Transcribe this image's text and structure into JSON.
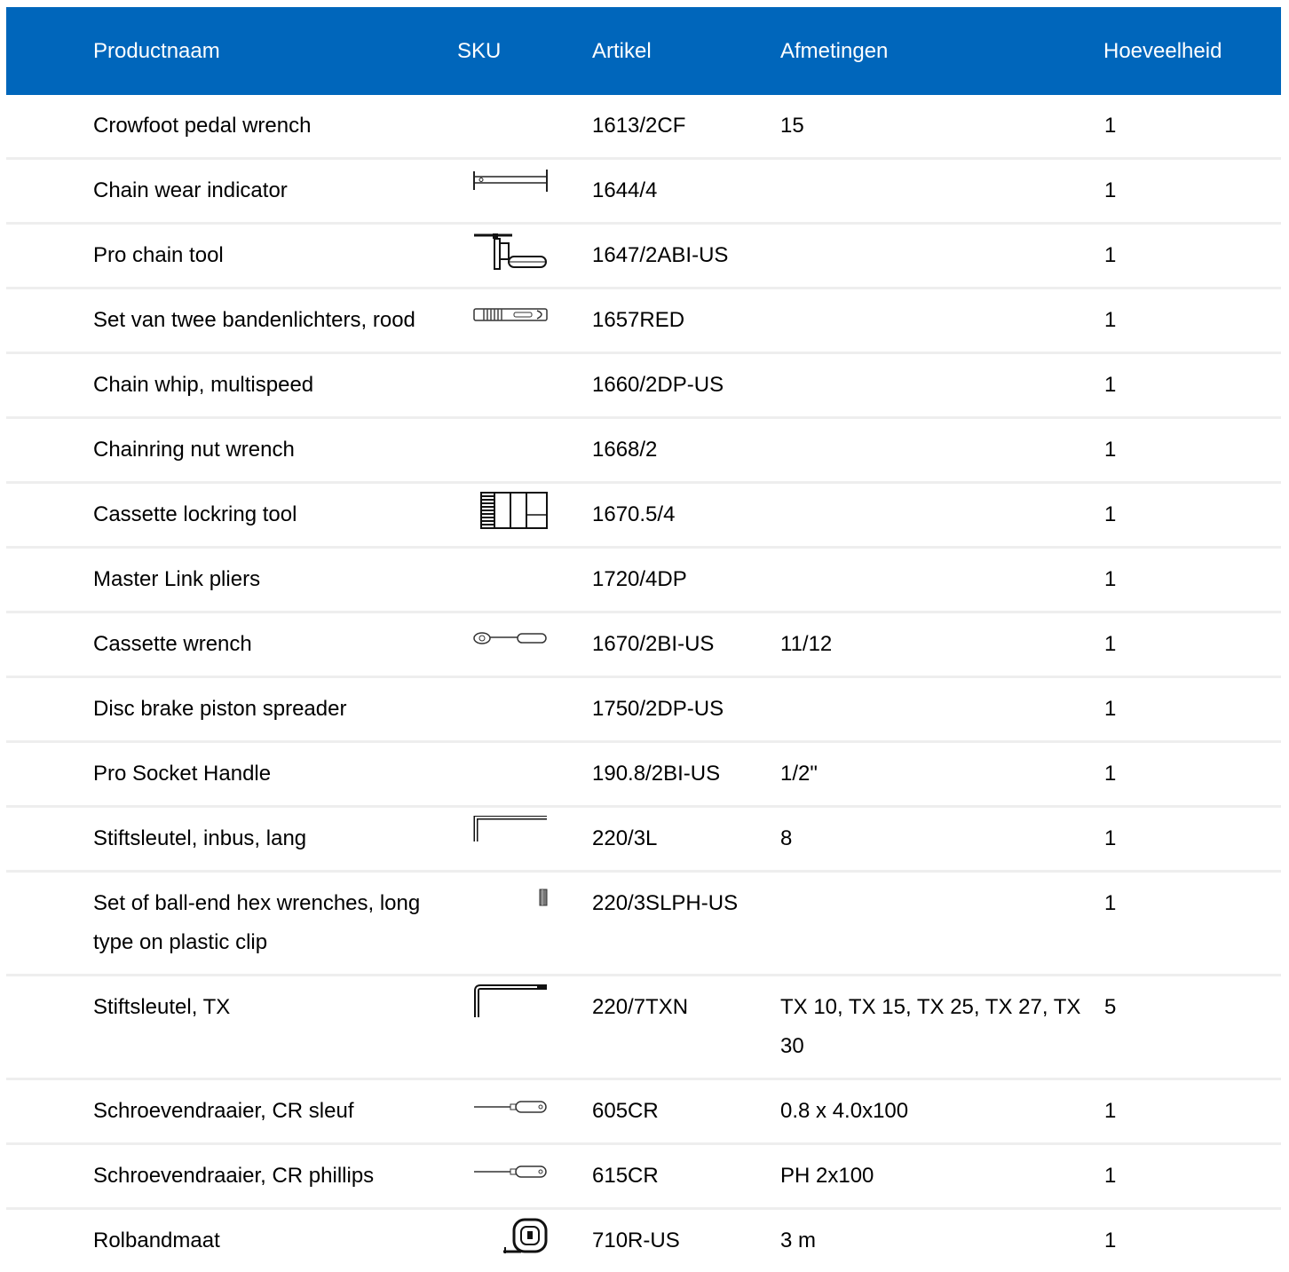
{
  "table": {
    "headers": {
      "product": "Productnaam",
      "sku": "SKU",
      "article": "Artikel",
      "dimensions": "Afmetingen",
      "quantity": "Hoeveelheid"
    },
    "colors": {
      "header_bg": "#0066bb",
      "header_text": "#ffffff",
      "row_divider": "#eeeeee"
    },
    "rows": [
      {
        "name": "Crowfoot pedal wrench",
        "icon": "",
        "article": "1613/2CF",
        "dimensions": "15",
        "qty": "1"
      },
      {
        "name": "Chain wear indicator",
        "icon": "chain-wear-indicator-icon",
        "article": "1644/4",
        "dimensions": "",
        "qty": "1"
      },
      {
        "name": "Pro chain tool",
        "icon": "chain-tool-icon",
        "article": "1647/2ABI-US",
        "dimensions": "",
        "qty": "1"
      },
      {
        "name": "Set van twee bandenlichters, rood",
        "icon": "tire-lever-icon",
        "article": "1657RED",
        "dimensions": "",
        "qty": "1"
      },
      {
        "name": "Chain whip, multispeed",
        "icon": "",
        "article": "1660/2DP-US",
        "dimensions": "",
        "qty": "1"
      },
      {
        "name": "Chainring nut wrench",
        "icon": "",
        "article": "1668/2",
        "dimensions": "",
        "qty": "1"
      },
      {
        "name": "Cassette lockring tool",
        "icon": "lockring-tool-icon",
        "article": "1670.5/4",
        "dimensions": "",
        "qty": "1"
      },
      {
        "name": "Master Link pliers",
        "icon": "",
        "article": "1720/4DP",
        "dimensions": "",
        "qty": "1"
      },
      {
        "name": "Cassette wrench",
        "icon": "ratchet-wrench-icon",
        "article": "1670/2BI-US",
        "dimensions": "11/12",
        "qty": "1"
      },
      {
        "name": "Disc brake piston spreader",
        "icon": "",
        "article": "1750/2DP-US",
        "dimensions": "",
        "qty": "1"
      },
      {
        "name": "Pro Socket Handle",
        "icon": "",
        "article": "190.8/2BI-US",
        "dimensions": "1/2\"",
        "qty": "1"
      },
      {
        "name": "Stiftsleutel, inbus, lang",
        "icon": "hex-key-long-icon",
        "article": "220/3L",
        "dimensions": "8",
        "qty": "1"
      },
      {
        "name": "Set of ball-end hex wrenches, long type on plastic clip",
        "icon": "hex-set-clip-icon",
        "article": "220/3SLPH-US",
        "dimensions": "",
        "qty": "1"
      },
      {
        "name": "Stiftsleutel, TX",
        "icon": "torx-key-icon",
        "article": "220/7TXN",
        "dimensions": "TX 10, TX 15, TX 25, TX 27, TX 30",
        "qty": "5"
      },
      {
        "name": "Schroevendraaier, CR sleuf",
        "icon": "flat-screwdriver-icon",
        "article": "605CR",
        "dimensions": "0.8 x 4.0x100",
        "qty": "1"
      },
      {
        "name": "Schroevendraaier, CR phillips",
        "icon": "phillips-screwdriver-icon",
        "article": "615CR",
        "dimensions": "PH 2x100",
        "qty": "1"
      },
      {
        "name": "Rolbandmaat",
        "icon": "tape-measure-icon",
        "article": "710R-US",
        "dimensions": "3 m",
        "qty": "1"
      }
    ]
  }
}
